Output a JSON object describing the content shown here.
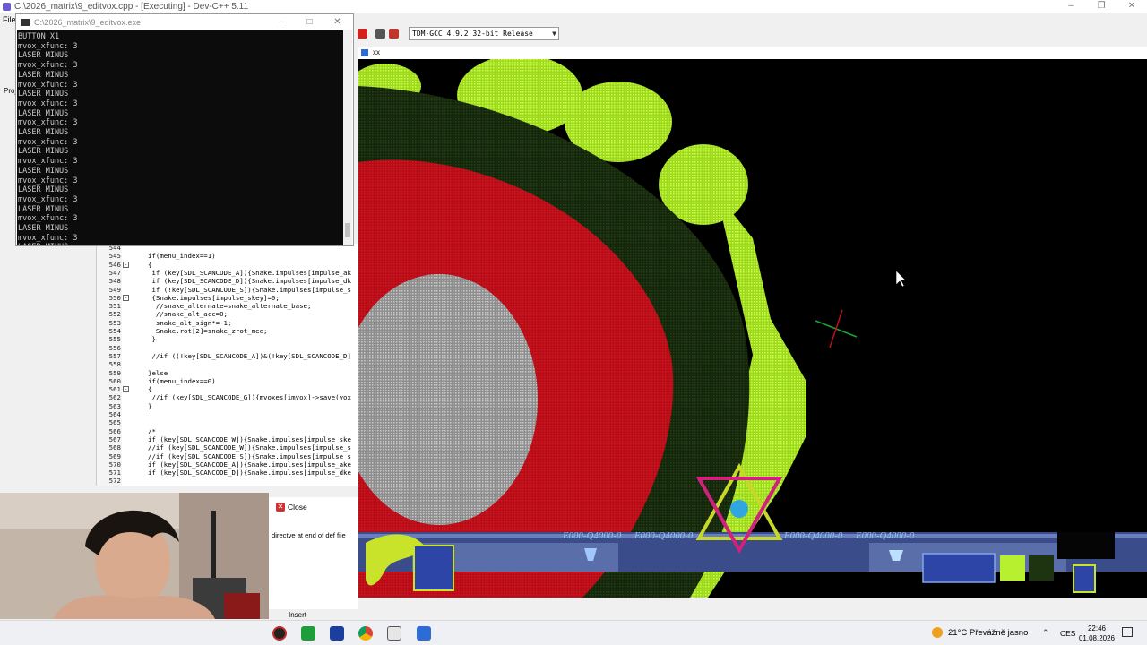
{
  "ide": {
    "title": "C:\\2026_matrix\\9_editvox.cpp - [Executing] - Dev-C++ 5.11",
    "menu_first": "File",
    "compiler": "TDM-GCC 4.9.2 32-bit Release",
    "left_tab_label": "Proj"
  },
  "console": {
    "title": "C:\\2026_matrix\\9_editvox.exe",
    "lines": [
      "BUTTON X1",
      "mvox_xfunc: 3",
      "LASER MINUS",
      "mvox_xfunc: 3",
      "LASER MINUS",
      "mvox_xfunc: 3",
      "LASER MINUS",
      "mvox_xfunc: 3",
      "LASER MINUS",
      "mvox_xfunc: 3",
      "LASER MINUS",
      "mvox_xfunc: 3",
      "LASER MINUS",
      "mvox_xfunc: 3",
      "LASER MINUS",
      "mvox_xfunc: 3",
      "LASER MINUS",
      "mvox_xfunc: 3",
      "LASER MINUS",
      "mvox_xfunc: 3",
      "LASER MINUS",
      "mvox_xfunc: 3",
      "LASER MINUS"
    ]
  },
  "editor": {
    "lines": [
      {
        "n": "544",
        "text": "",
        "fold": ""
      },
      {
        "n": "545",
        "text": "if(menu_index==1)",
        "fold": ""
      },
      {
        "n": "546",
        "text": "{",
        "fold": "-"
      },
      {
        "n": "547",
        "text": " if (key[SDL_SCANCODE_A]){Snake.impulses[impulse_ak",
        "fold": ""
      },
      {
        "n": "548",
        "text": " if (key[SDL_SCANCODE_D]){Snake.impulses[impulse_dk",
        "fold": ""
      },
      {
        "n": "549",
        "text": " if (!key[SDL_SCANCODE_S]){Snake.impulses[impulse_s",
        "fold": ""
      },
      {
        "n": "550",
        "text": " {Snake.impulses[impulse_skey]=0;",
        "fold": "-"
      },
      {
        "n": "551",
        "text": "  //snake_alternate=snake_alternate_base;",
        "fold": ""
      },
      {
        "n": "552",
        "text": "  //snake_alt_acc=0;",
        "fold": ""
      },
      {
        "n": "553",
        "text": "  snake_alt_sign*=-1;",
        "fold": ""
      },
      {
        "n": "554",
        "text": "  Snake.rot[2]=snake_zrot_mee;",
        "fold": ""
      },
      {
        "n": "555",
        "text": " }",
        "fold": ""
      },
      {
        "n": "556",
        "text": "",
        "fold": ""
      },
      {
        "n": "557",
        "text": " //if ((!key[SDL_SCANCODE_A])&(!key[SDL_SCANCODE_D]",
        "fold": ""
      },
      {
        "n": "558",
        "text": "",
        "fold": ""
      },
      {
        "n": "559",
        "text": "}else",
        "fold": ""
      },
      {
        "n": "560",
        "text": "if(menu_index==0)",
        "fold": ""
      },
      {
        "n": "561",
        "text": "{",
        "fold": "-"
      },
      {
        "n": "562",
        "text": " //if (key[SDL_SCANCODE_G]){mvoxes[imvox]->save(vox",
        "fold": ""
      },
      {
        "n": "563",
        "text": "}",
        "fold": ""
      },
      {
        "n": "564",
        "text": "",
        "fold": ""
      },
      {
        "n": "565",
        "text": "",
        "fold": ""
      },
      {
        "n": "566",
        "text": "/*",
        "fold": ""
      },
      {
        "n": "567",
        "text": "if (key[SDL_SCANCODE_W]){Snake.impulses[impulse_ske",
        "fold": ""
      },
      {
        "n": "568",
        "text": "//if (key[SDL_SCANCODE_W]){Snake.impulses[impulse_s",
        "fold": ""
      },
      {
        "n": "569",
        "text": "//if (key[SDL_SCANCODE_S]){Snake.impulses[impulse_s",
        "fold": ""
      },
      {
        "n": "570",
        "text": "if (key[SDL_SCANCODE_A]){Snake.impulses[impulse_ake",
        "fold": ""
      },
      {
        "n": "571",
        "text": "if (key[SDL_SCANCODE_D]){Snake.impulses[impulse_dke",
        "fold": ""
      },
      {
        "n": "572",
        "text": "",
        "fold": ""
      }
    ]
  },
  "bottom": {
    "close_label": "Close",
    "message": "directve at end of def file",
    "status": "Insert"
  },
  "game": {
    "tab_title": "xx",
    "hud_counters": [
      "E000-Q4000-0",
      "E000-Q4000-0",
      "E000-Q4000-0",
      "E000-Q4000-0"
    ]
  },
  "taskbar": {
    "weather": "21°C  Převážně jasno",
    "lang": "CES",
    "time": "22:46",
    "date": "01.08.2026"
  },
  "colors": {
    "game_green": "#b6f02e",
    "game_red": "#c8101a",
    "game_dark_green": "#1e3410"
  }
}
